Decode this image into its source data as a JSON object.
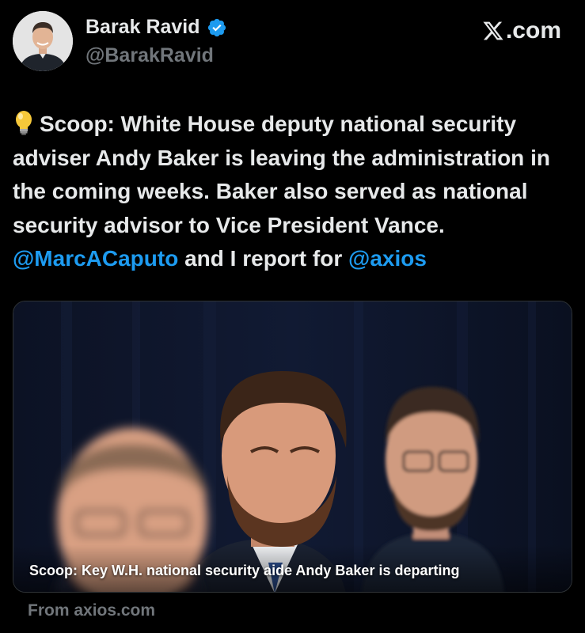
{
  "author": {
    "name": "Barak Ravid",
    "handle": "@BarakRavid",
    "verified": true
  },
  "brand": {
    "label": ".com"
  },
  "tweet": {
    "emoji": "light-bulb-icon",
    "text_intro": "Scoop: White House deputy national security adviser Andy Baker is leaving the administration in the coming weeks. Baker also served as national security advisor to Vice President Vance. ",
    "mention_1": "@MarcACaputo",
    "text_mid": " and I report for ",
    "mention_2": "@axios"
  },
  "card": {
    "headline": "Scoop: Key W.H. national security aide Andy Baker is departing",
    "source": "From axios.com"
  },
  "colors": {
    "background": "#000000",
    "text": "#e7e9ea",
    "muted": "#71767b",
    "link": "#1d9bf0",
    "verified": "#1d9bf0"
  }
}
